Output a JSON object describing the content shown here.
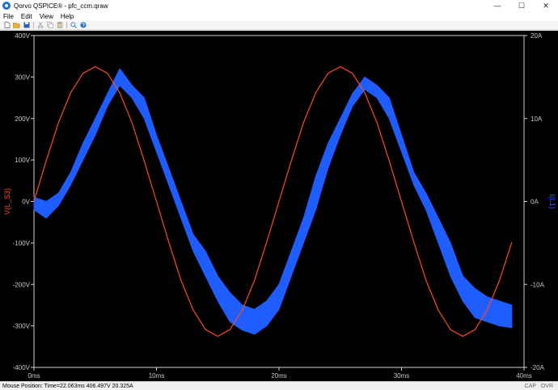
{
  "window": {
    "title": "Qorvo QSPICE® - pfc_ccm.qraw",
    "controls": {
      "minimize": "—",
      "maximize": "☐",
      "close": "✕"
    }
  },
  "menu": [
    "File",
    "Edit",
    "View",
    "Help"
  ],
  "toolbar": {
    "icons": [
      "new-icon",
      "open-icon",
      "save-icon",
      "cut-icon",
      "copy-icon",
      "paste-icon",
      "zoom-icon",
      "help-icon"
    ]
  },
  "status": {
    "mouse_position": "Mouse Position: Time=22.063ms  406.497V 20.325A",
    "flags": [
      "CAP",
      "OVR"
    ]
  },
  "colors": {
    "plot_background": "#000000",
    "axis": "#d0d0d0",
    "tick_label": "#c8c8c8",
    "voltage_trace": "#ff4a1c",
    "current_trace": "#1f5dff"
  },
  "chart_data": {
    "type": "line",
    "title": "",
    "xlabel": "",
    "x_ticks": [
      "0ms",
      "10ms",
      "20ms",
      "30ms",
      "40ms"
    ],
    "xlim": [
      0,
      40
    ],
    "y_left": {
      "label": "V(L_S3)",
      "ticks": [
        "400V",
        "300V",
        "200V",
        "100V",
        "0V",
        "-100V",
        "-200V",
        "-300V",
        "-400V"
      ],
      "ylim": [
        -400,
        400
      ],
      "color": "#ff4a1c"
    },
    "y_right": {
      "label": "I(L1)",
      "ticks": [
        "20A",
        "10A",
        "0A",
        "-10A",
        "-20A"
      ],
      "ylim": [
        -20,
        20
      ],
      "color": "#1f5dff"
    },
    "grid": false,
    "series": [
      {
        "name": "V(L_S3)",
        "axis": "left",
        "x": [
          0,
          1,
          2,
          3,
          4,
          5,
          6,
          7,
          8,
          9,
          10,
          11,
          12,
          13,
          14,
          15,
          16,
          17,
          18,
          19,
          20,
          21,
          22,
          23,
          24,
          25,
          26,
          27,
          28,
          29,
          30,
          31,
          32,
          33,
          34,
          35,
          36,
          37,
          38,
          39
        ],
        "y": [
          0,
          98,
          190,
          262,
          309,
          325,
          309,
          262,
          190,
          98,
          0,
          -98,
          -190,
          -262,
          -309,
          -325,
          -309,
          -262,
          -190,
          -98,
          0,
          98,
          190,
          262,
          309,
          325,
          309,
          262,
          190,
          98,
          0,
          -98,
          -190,
          -262,
          -309,
          -325,
          -309,
          -262,
          -190,
          -98
        ]
      },
      {
        "name": "I(L1)",
        "axis": "right",
        "x": [
          0,
          1,
          2,
          3,
          4,
          5,
          6,
          7,
          8,
          9,
          10,
          11,
          12,
          13,
          14,
          15,
          16,
          17,
          18,
          19,
          20,
          21,
          22,
          23,
          24,
          25,
          26,
          27,
          28,
          29,
          30,
          31,
          32,
          33,
          34,
          35,
          36,
          37,
          38,
          39
        ],
        "y_min": [
          -1,
          -2,
          -0.5,
          2,
          5,
          8,
          11.5,
          14,
          12.5,
          10,
          6,
          2,
          -2,
          -6,
          -9,
          -12,
          -14.5,
          -15.5,
          -16,
          -15,
          -13,
          -9,
          -5,
          -1,
          4,
          8,
          11.5,
          13.5,
          12.5,
          10,
          6,
          2,
          -1,
          -5,
          -9,
          -12,
          -14,
          -14.5,
          -15,
          -15.2
        ],
        "y_max": [
          0.5,
          0,
          1,
          3.5,
          7,
          10,
          13,
          16,
          14,
          12.5,
          8,
          4,
          0,
          -4,
          -6,
          -9,
          -11,
          -12.5,
          -13,
          -12,
          -10,
          -6,
          -2,
          3,
          7,
          10,
          13,
          15,
          14,
          12.5,
          8,
          3.5,
          1,
          -2,
          -5,
          -9,
          -10.5,
          -11.5,
          -12,
          -12.5
        ]
      }
    ]
  }
}
